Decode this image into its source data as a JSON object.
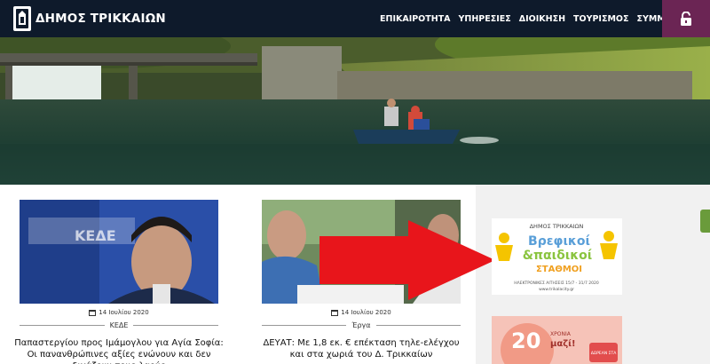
{
  "header": {
    "logo_text": "ΔΗΜΟΣ ΤΡΙΚΚΑΙΩΝ",
    "logo_icon": "municipality-emblem-icon",
    "bar_color": "#0e1a2b",
    "nav": [
      {
        "label": "ΕΠΙΚΑΙΡΟΤΗΤΑ"
      },
      {
        "label": "ΥΠΗΡΕΣΙΕΣ"
      },
      {
        "label": "ΔΙΟΙΚΗΣΗ"
      },
      {
        "label": "ΤΟΥΡΙΣΜΟΣ"
      },
      {
        "label": "ΣΥΜΜΕΤΕΧΩ!"
      }
    ],
    "login_icon": "unlock-icon",
    "login_color": "#6b2554"
  },
  "articles": [
    {
      "date": "14 Ιουλίου 2020",
      "category": "ΚΕΔΕ",
      "title": "Παπαστεργίου προς Ιμάμογλου για Αγία Σοφία: Οι πανανθρώπινες αξίες ενώνουν και δεν διχάζουν τους λαούς",
      "image_text": "ΚΕΔΕ"
    },
    {
      "date": "14 Ιουλίου 2020",
      "category": "Έργα",
      "title": "ΔΕΥΑΤ: Με 1,8 εκ. € επέκταση τηλε-ελέγχου και στα χωριά του Δ. Τρικκαίων"
    }
  ],
  "banners": {
    "nurseries": {
      "top": "ΔΗΜΟΣ ΤΡΙΚΚΑΙΩΝ",
      "line1": "Βρεφικοί",
      "line2": "&παιδικοί",
      "line3": "ΣΤΑΘΜΟΙ",
      "small": "ΗΛΕΚΤΡΟΝΙΚΕΣ ΑΙΤΗΣΕΙΣ 15/7 - 31/7 2020",
      "url": "www.trikalacity.gr"
    },
    "anniversary": {
      "number": "20",
      "line1": "ΧΡΟΝΙΑ",
      "line2": "μαζί!",
      "badge": "ΔΩΡΕΑΝ ΣΤΑ"
    }
  },
  "colors": {
    "accent_green": "#6a9b3b",
    "arrow_red": "#e8151b"
  }
}
